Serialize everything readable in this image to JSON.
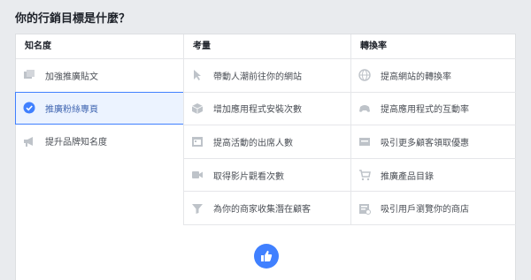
{
  "title": "你的行銷目標是什麼？",
  "columns": [
    {
      "header": "知名度",
      "items": [
        {
          "label": "加強推廣貼文",
          "icon": "post-icon",
          "selected": false
        },
        {
          "label": "推廣粉絲專頁",
          "icon": "checkmark-icon",
          "selected": true
        },
        {
          "label": "提升品牌知名度",
          "icon": "megaphone-icon",
          "selected": false
        }
      ]
    },
    {
      "header": "考量",
      "items": [
        {
          "label": "帶動人潮前往你的網站",
          "icon": "cursor-icon"
        },
        {
          "label": "增加應用程式安裝次數",
          "icon": "cube-icon"
        },
        {
          "label": "提高活動的出席人數",
          "icon": "calendar-icon"
        },
        {
          "label": "取得影片觀看次數",
          "icon": "video-icon"
        },
        {
          "label": "為你的商家收集潛在顧客",
          "icon": "filter-icon"
        }
      ]
    },
    {
      "header": "轉換率",
      "items": [
        {
          "label": "提高網站的轉換率",
          "icon": "globe-icon"
        },
        {
          "label": "提高應用程式的互動率",
          "icon": "gamepad-icon"
        },
        {
          "label": "吸引更多顧客領取優惠",
          "icon": "offer-icon"
        },
        {
          "label": "推廣產品目錄",
          "icon": "cart-icon"
        },
        {
          "label": "吸引用戶瀏覽你的商店",
          "icon": "store-icon"
        }
      ]
    }
  ],
  "colors": {
    "selected_border": "#4080ff",
    "selected_bg": "#ecf3ff",
    "selected_text": "#4267b2",
    "icon": "#bec3c9"
  },
  "footer_icon": "thumbs-up-icon"
}
